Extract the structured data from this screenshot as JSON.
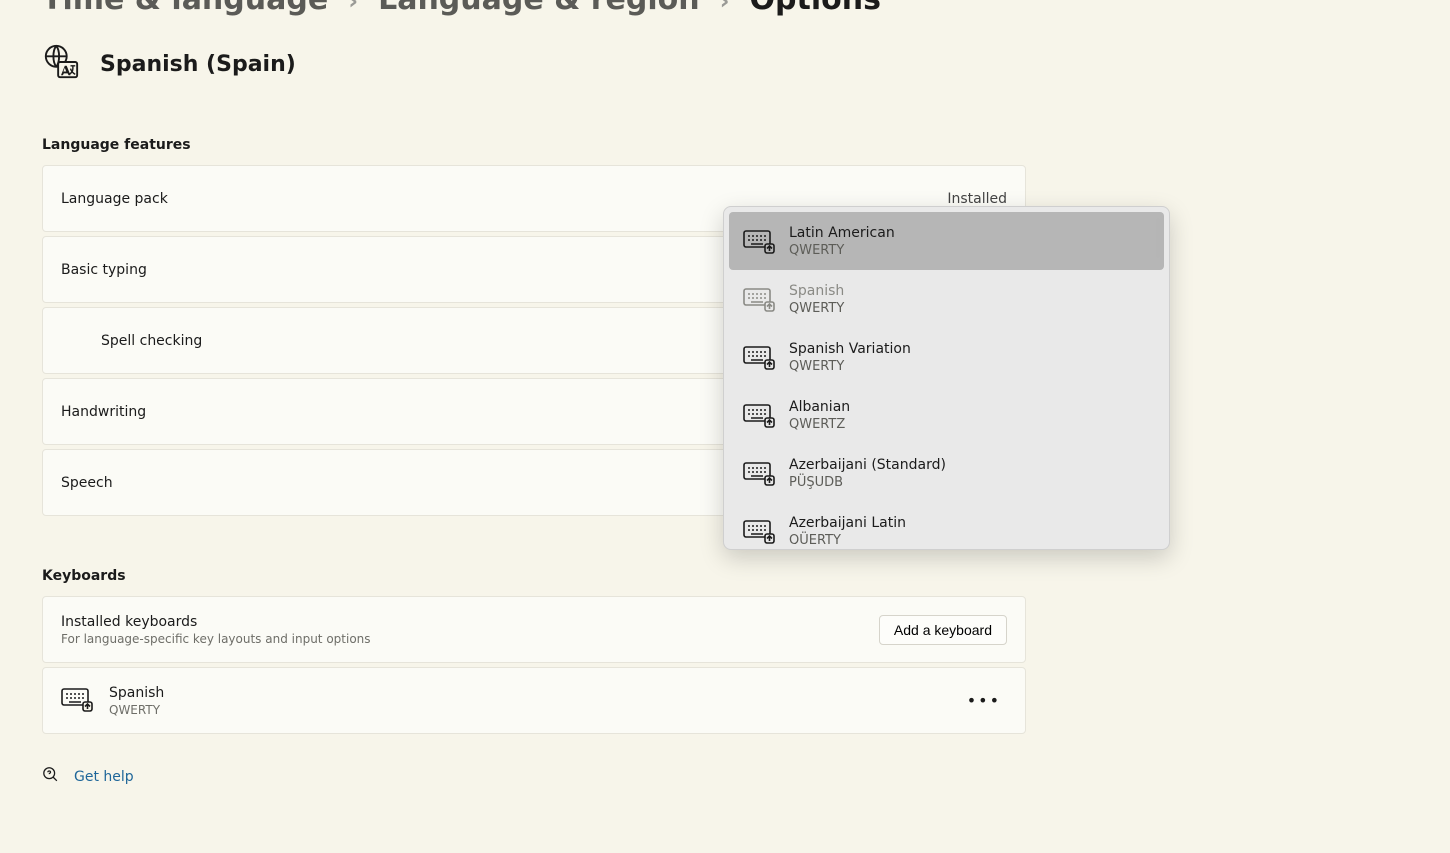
{
  "breadcrumb": {
    "level1": "Time & language",
    "level2": "Language & region",
    "current": "Options"
  },
  "language": {
    "name": "Spanish (Spain)"
  },
  "sections": {
    "features_label": "Language features",
    "keyboards_label": "Keyboards"
  },
  "features": [
    {
      "label": "Language pack",
      "status": "Installed",
      "indent": false
    },
    {
      "label": "Basic typing",
      "status": "",
      "indent": false
    },
    {
      "label": "Spell checking",
      "status": "",
      "indent": true
    },
    {
      "label": "Handwriting",
      "status": "",
      "indent": false
    },
    {
      "label": "Speech",
      "status": "",
      "indent": false
    }
  ],
  "keyboards": {
    "installed_title": "Installed keyboards",
    "installed_sub": "For language-specific key layouts and input options",
    "add_button": "Add a keyboard",
    "list": [
      {
        "name": "Spanish",
        "layout": "QWERTY"
      }
    ]
  },
  "help": {
    "label": "Get help"
  },
  "popup": {
    "items": [
      {
        "name": "Latin American",
        "layout": "QWERTY",
        "selected": true,
        "disabled": false
      },
      {
        "name": "Spanish",
        "layout": "QWERTY",
        "selected": false,
        "disabled": true
      },
      {
        "name": "Spanish Variation",
        "layout": "QWERTY",
        "selected": false,
        "disabled": false
      },
      {
        "name": "Albanian",
        "layout": "QWERTZ",
        "selected": false,
        "disabled": false
      },
      {
        "name": "Azerbaijani (Standard)",
        "layout": "PÜŞUDB",
        "selected": false,
        "disabled": false
      },
      {
        "name": "Azerbaijani Latin",
        "layout": "QÜERTY",
        "selected": false,
        "disabled": false
      }
    ]
  }
}
